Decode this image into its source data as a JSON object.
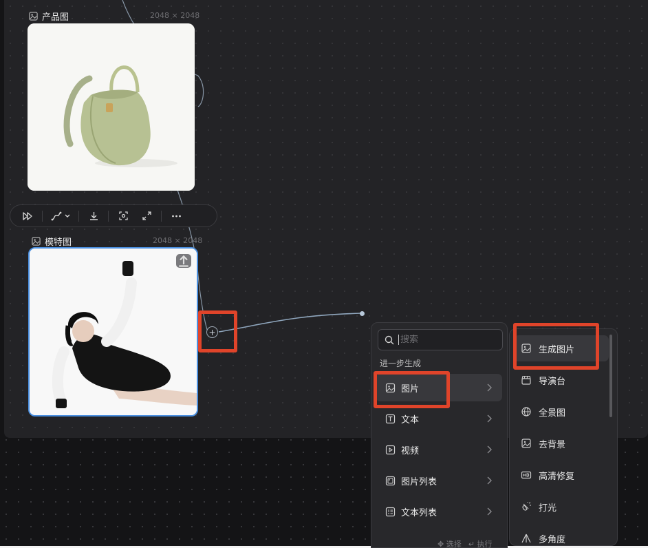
{
  "nodes": {
    "product": {
      "title": "产品图",
      "size": "2048 × 2048"
    },
    "model": {
      "title": "模特图",
      "size": "2048 × 2048"
    }
  },
  "toolbar": {
    "icons": [
      "fast-forward-icon",
      "curve-icon",
      "chevron-down-icon",
      "download-icon",
      "focus-icon",
      "expand-icon",
      "more-icon"
    ]
  },
  "menu": {
    "search_placeholder": "搜索",
    "section": "进一步生成",
    "items": [
      {
        "label": "图片",
        "icon": "image-icon"
      },
      {
        "label": "文本",
        "icon": "text-icon"
      },
      {
        "label": "视频",
        "icon": "video-icon"
      },
      {
        "label": "图片列表",
        "icon": "image-list-icon"
      },
      {
        "label": "文本列表",
        "icon": "text-list-icon"
      }
    ],
    "footer": {
      "select": "选择",
      "execute": "执行"
    }
  },
  "submenu": {
    "items": [
      {
        "label": "生成图片",
        "icon": "image-icon"
      },
      {
        "label": "导演台",
        "icon": "clapperboard-icon"
      },
      {
        "label": "全景图",
        "icon": "globe-icon"
      },
      {
        "label": "去背景",
        "icon": "image-icon"
      },
      {
        "label": "高清修复",
        "icon": "hd-icon"
      },
      {
        "label": "打光",
        "icon": "light-icon"
      },
      {
        "label": "多角度",
        "icon": "angle-icon"
      }
    ]
  },
  "colors": {
    "highlight": "#e0442a",
    "selection": "#4a8fe0",
    "wire": "#9db3c9"
  }
}
